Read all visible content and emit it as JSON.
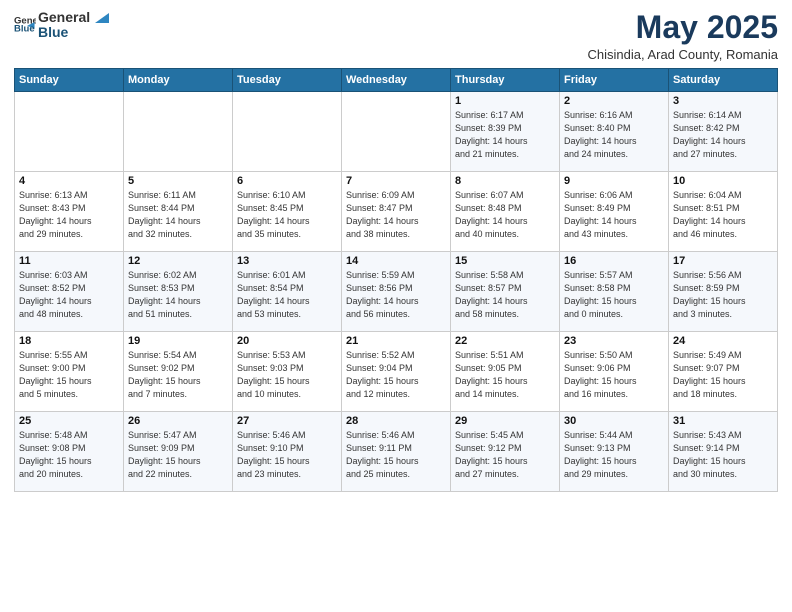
{
  "logo": {
    "general": "General",
    "blue": "Blue"
  },
  "title": "May 2025",
  "subtitle": "Chisindia, Arad County, Romania",
  "header_days": [
    "Sunday",
    "Monday",
    "Tuesday",
    "Wednesday",
    "Thursday",
    "Friday",
    "Saturday"
  ],
  "weeks": [
    [
      {
        "day": "",
        "info": ""
      },
      {
        "day": "",
        "info": ""
      },
      {
        "day": "",
        "info": ""
      },
      {
        "day": "",
        "info": ""
      },
      {
        "day": "1",
        "info": "Sunrise: 6:17 AM\nSunset: 8:39 PM\nDaylight: 14 hours\nand 21 minutes."
      },
      {
        "day": "2",
        "info": "Sunrise: 6:16 AM\nSunset: 8:40 PM\nDaylight: 14 hours\nand 24 minutes."
      },
      {
        "day": "3",
        "info": "Sunrise: 6:14 AM\nSunset: 8:42 PM\nDaylight: 14 hours\nand 27 minutes."
      }
    ],
    [
      {
        "day": "4",
        "info": "Sunrise: 6:13 AM\nSunset: 8:43 PM\nDaylight: 14 hours\nand 29 minutes."
      },
      {
        "day": "5",
        "info": "Sunrise: 6:11 AM\nSunset: 8:44 PM\nDaylight: 14 hours\nand 32 minutes."
      },
      {
        "day": "6",
        "info": "Sunrise: 6:10 AM\nSunset: 8:45 PM\nDaylight: 14 hours\nand 35 minutes."
      },
      {
        "day": "7",
        "info": "Sunrise: 6:09 AM\nSunset: 8:47 PM\nDaylight: 14 hours\nand 38 minutes."
      },
      {
        "day": "8",
        "info": "Sunrise: 6:07 AM\nSunset: 8:48 PM\nDaylight: 14 hours\nand 40 minutes."
      },
      {
        "day": "9",
        "info": "Sunrise: 6:06 AM\nSunset: 8:49 PM\nDaylight: 14 hours\nand 43 minutes."
      },
      {
        "day": "10",
        "info": "Sunrise: 6:04 AM\nSunset: 8:51 PM\nDaylight: 14 hours\nand 46 minutes."
      }
    ],
    [
      {
        "day": "11",
        "info": "Sunrise: 6:03 AM\nSunset: 8:52 PM\nDaylight: 14 hours\nand 48 minutes."
      },
      {
        "day": "12",
        "info": "Sunrise: 6:02 AM\nSunset: 8:53 PM\nDaylight: 14 hours\nand 51 minutes."
      },
      {
        "day": "13",
        "info": "Sunrise: 6:01 AM\nSunset: 8:54 PM\nDaylight: 14 hours\nand 53 minutes."
      },
      {
        "day": "14",
        "info": "Sunrise: 5:59 AM\nSunset: 8:56 PM\nDaylight: 14 hours\nand 56 minutes."
      },
      {
        "day": "15",
        "info": "Sunrise: 5:58 AM\nSunset: 8:57 PM\nDaylight: 14 hours\nand 58 minutes."
      },
      {
        "day": "16",
        "info": "Sunrise: 5:57 AM\nSunset: 8:58 PM\nDaylight: 15 hours\nand 0 minutes."
      },
      {
        "day": "17",
        "info": "Sunrise: 5:56 AM\nSunset: 8:59 PM\nDaylight: 15 hours\nand 3 minutes."
      }
    ],
    [
      {
        "day": "18",
        "info": "Sunrise: 5:55 AM\nSunset: 9:00 PM\nDaylight: 15 hours\nand 5 minutes."
      },
      {
        "day": "19",
        "info": "Sunrise: 5:54 AM\nSunset: 9:02 PM\nDaylight: 15 hours\nand 7 minutes."
      },
      {
        "day": "20",
        "info": "Sunrise: 5:53 AM\nSunset: 9:03 PM\nDaylight: 15 hours\nand 10 minutes."
      },
      {
        "day": "21",
        "info": "Sunrise: 5:52 AM\nSunset: 9:04 PM\nDaylight: 15 hours\nand 12 minutes."
      },
      {
        "day": "22",
        "info": "Sunrise: 5:51 AM\nSunset: 9:05 PM\nDaylight: 15 hours\nand 14 minutes."
      },
      {
        "day": "23",
        "info": "Sunrise: 5:50 AM\nSunset: 9:06 PM\nDaylight: 15 hours\nand 16 minutes."
      },
      {
        "day": "24",
        "info": "Sunrise: 5:49 AM\nSunset: 9:07 PM\nDaylight: 15 hours\nand 18 minutes."
      }
    ],
    [
      {
        "day": "25",
        "info": "Sunrise: 5:48 AM\nSunset: 9:08 PM\nDaylight: 15 hours\nand 20 minutes."
      },
      {
        "day": "26",
        "info": "Sunrise: 5:47 AM\nSunset: 9:09 PM\nDaylight: 15 hours\nand 22 minutes."
      },
      {
        "day": "27",
        "info": "Sunrise: 5:46 AM\nSunset: 9:10 PM\nDaylight: 15 hours\nand 23 minutes."
      },
      {
        "day": "28",
        "info": "Sunrise: 5:46 AM\nSunset: 9:11 PM\nDaylight: 15 hours\nand 25 minutes."
      },
      {
        "day": "29",
        "info": "Sunrise: 5:45 AM\nSunset: 9:12 PM\nDaylight: 15 hours\nand 27 minutes."
      },
      {
        "day": "30",
        "info": "Sunrise: 5:44 AM\nSunset: 9:13 PM\nDaylight: 15 hours\nand 29 minutes."
      },
      {
        "day": "31",
        "info": "Sunrise: 5:43 AM\nSunset: 9:14 PM\nDaylight: 15 hours\nand 30 minutes."
      }
    ]
  ]
}
